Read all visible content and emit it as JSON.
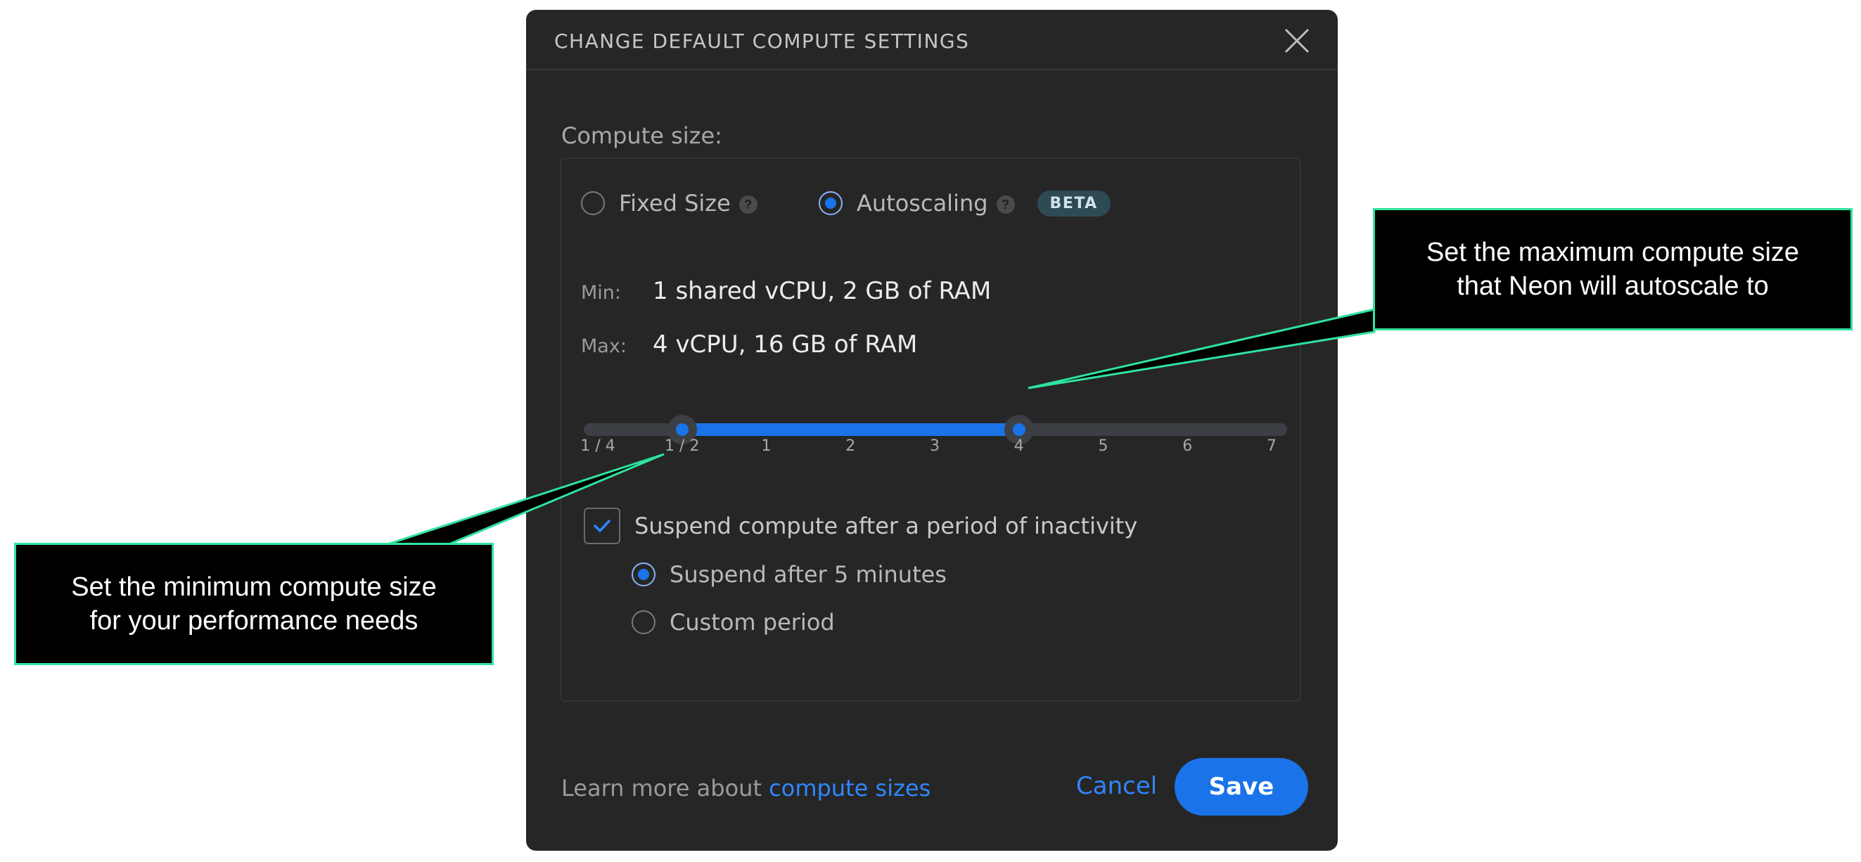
{
  "dialog": {
    "title": "CHANGE DEFAULT COMPUTE SETTINGS",
    "close_icon": "close-icon"
  },
  "compute": {
    "section_label": "Compute size:",
    "options": [
      {
        "label": "Fixed Size",
        "selected": false,
        "help_icon": "?"
      },
      {
        "label": "Autoscaling",
        "selected": true,
        "help_icon": "?",
        "badge": "BETA"
      }
    ],
    "min_key": "Min:",
    "min_value": "1 shared vCPU, 2 GB of RAM",
    "max_key": "Max:",
    "max_value": "4 vCPU, 16 GB of RAM"
  },
  "slider": {
    "ticks": [
      "1 / 4",
      "1 / 2",
      "1",
      "2",
      "3",
      "4",
      "5",
      "6",
      "7"
    ],
    "min_index": 1,
    "max_index": 5,
    "accent": "#1a73e8"
  },
  "suspend": {
    "checkbox_label": "Suspend compute after a period of inactivity",
    "checked": true,
    "options": [
      {
        "label": "Suspend after 5 minutes",
        "selected": true
      },
      {
        "label": "Custom period",
        "selected": false
      }
    ]
  },
  "footer": {
    "learn_prefix": "Learn more about ",
    "learn_link": "compute sizes",
    "cancel_label": "Cancel",
    "save_label": "Save"
  },
  "callouts": {
    "max_text": "Set the maximum compute size\nthat Neon will autoscale to",
    "min_text": "Set the minimum compute size\nfor your performance needs",
    "border_color": "#2fe39e"
  }
}
